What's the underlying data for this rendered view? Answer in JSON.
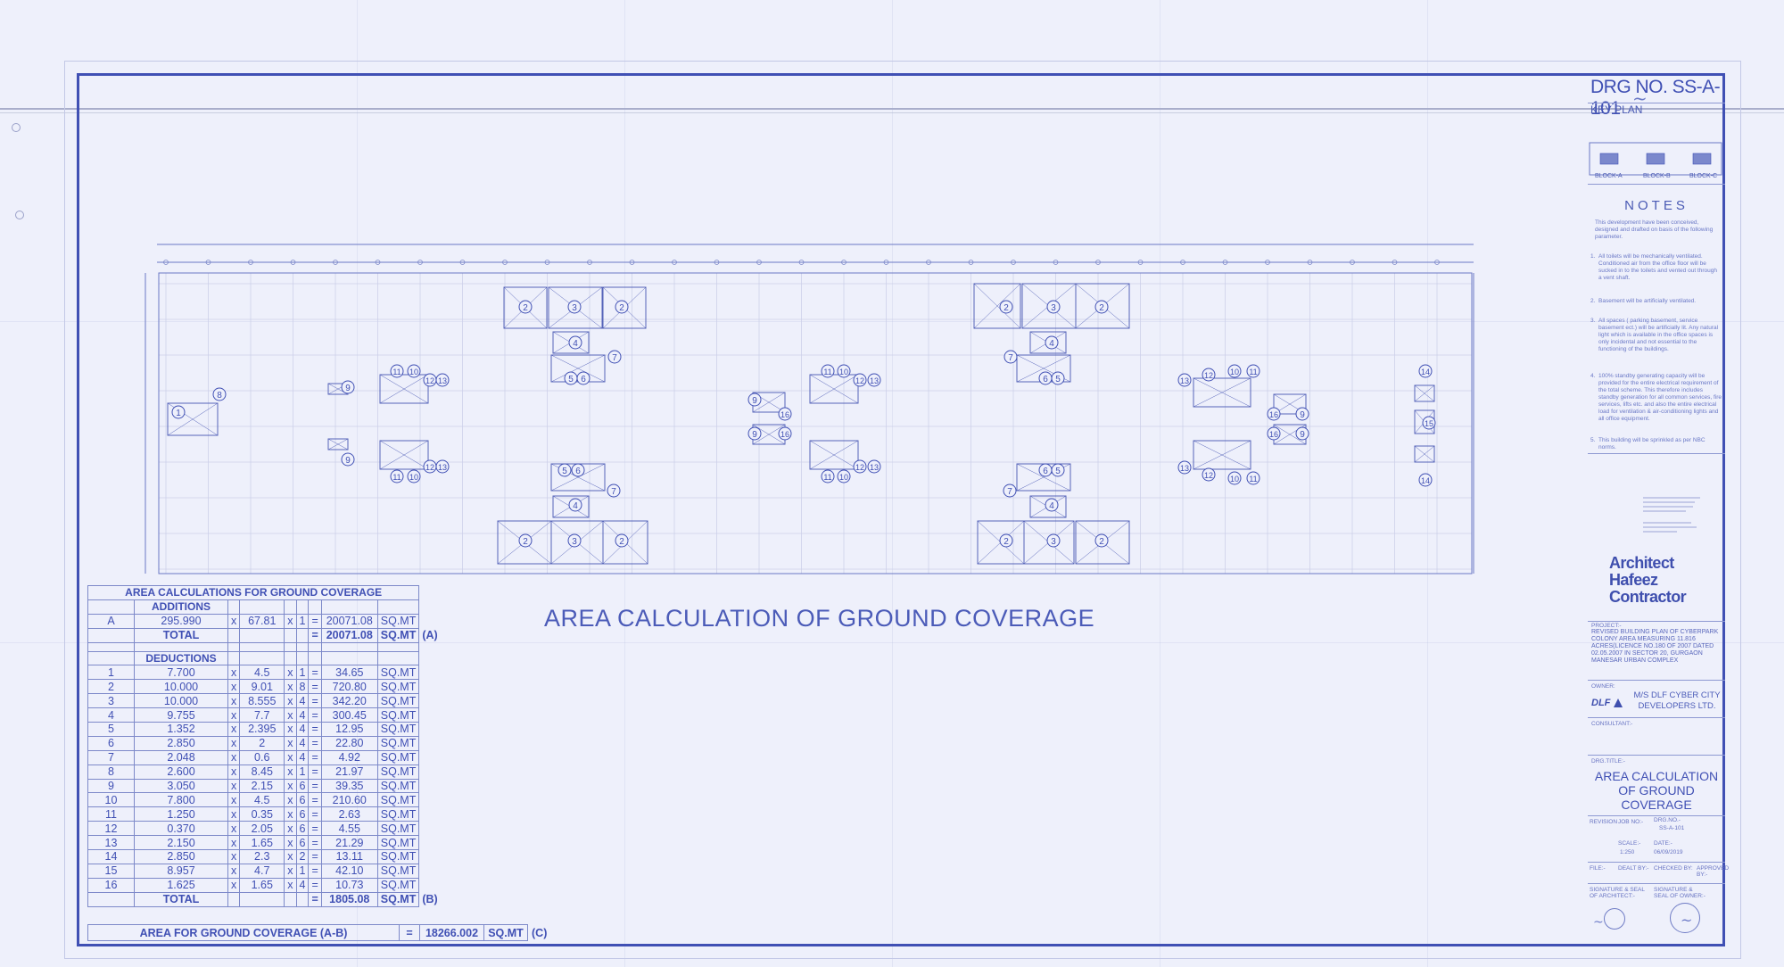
{
  "drawing_number": "DRG NO. SS-A-101",
  "plan_title": "AREA CALCULATION OF GROUND COVERAGE",
  "calc_table": {
    "title": "AREA CALCULATIONS FOR GROUND COVERAGE",
    "additions_header": "ADDITIONS",
    "additions": [
      {
        "id": "A",
        "area": "295.990",
        "x1": "x",
        "mult1": "67.81",
        "x2": "x",
        "mult2": "1",
        "eq": "=",
        "result": "20071.08",
        "unit": "SQ.MT"
      }
    ],
    "additions_total": {
      "label": "TOTAL",
      "eq": "=",
      "result": "20071.08",
      "unit": "SQ.MT",
      "tag": "(A)"
    },
    "deductions_header": "DEDUCTIONS",
    "deductions": [
      {
        "id": "1",
        "area": "7.700",
        "x1": "x",
        "mult1": "4.5",
        "x2": "x",
        "mult2": "1",
        "eq": "=",
        "result": "34.65",
        "unit": "SQ.MT"
      },
      {
        "id": "2",
        "area": "10.000",
        "x1": "x",
        "mult1": "9.01",
        "x2": "x",
        "mult2": "8",
        "eq": "=",
        "result": "720.80",
        "unit": "SQ.MT"
      },
      {
        "id": "3",
        "area": "10.000",
        "x1": "x",
        "mult1": "8.555",
        "x2": "x",
        "mult2": "4",
        "eq": "=",
        "result": "342.20",
        "unit": "SQ.MT"
      },
      {
        "id": "4",
        "area": "9.755",
        "x1": "x",
        "mult1": "7.7",
        "x2": "x",
        "mult2": "4",
        "eq": "=",
        "result": "300.45",
        "unit": "SQ.MT"
      },
      {
        "id": "5",
        "area": "1.352",
        "x1": "x",
        "mult1": "2.395",
        "x2": "x",
        "mult2": "4",
        "eq": "=",
        "result": "12.95",
        "unit": "SQ.MT"
      },
      {
        "id": "6",
        "area": "2.850",
        "x1": "x",
        "mult1": "2",
        "x2": "x",
        "mult2": "4",
        "eq": "=",
        "result": "22.80",
        "unit": "SQ.MT"
      },
      {
        "id": "7",
        "area": "2.048",
        "x1": "x",
        "mult1": "0.6",
        "x2": "x",
        "mult2": "4",
        "eq": "=",
        "result": "4.92",
        "unit": "SQ.MT"
      },
      {
        "id": "8",
        "area": "2.600",
        "x1": "x",
        "mult1": "8.45",
        "x2": "x",
        "mult2": "1",
        "eq": "=",
        "result": "21.97",
        "unit": "SQ.MT"
      },
      {
        "id": "9",
        "area": "3.050",
        "x1": "x",
        "mult1": "2.15",
        "x2": "x",
        "mult2": "6",
        "eq": "=",
        "result": "39.35",
        "unit": "SQ.MT"
      },
      {
        "id": "10",
        "area": "7.800",
        "x1": "x",
        "mult1": "4.5",
        "x2": "x",
        "mult2": "6",
        "eq": "=",
        "result": "210.60",
        "unit": "SQ.MT"
      },
      {
        "id": "11",
        "area": "1.250",
        "x1": "x",
        "mult1": "0.35",
        "x2": "x",
        "mult2": "6",
        "eq": "=",
        "result": "2.63",
        "unit": "SQ.MT"
      },
      {
        "id": "12",
        "area": "0.370",
        "x1": "x",
        "mult1": "2.05",
        "x2": "x",
        "mult2": "6",
        "eq": "=",
        "result": "4.55",
        "unit": "SQ.MT"
      },
      {
        "id": "13",
        "area": "2.150",
        "x1": "x",
        "mult1": "1.65",
        "x2": "x",
        "mult2": "6",
        "eq": "=",
        "result": "21.29",
        "unit": "SQ.MT"
      },
      {
        "id": "14",
        "area": "2.850",
        "x1": "x",
        "mult1": "2.3",
        "x2": "x",
        "mult2": "2",
        "eq": "=",
        "result": "13.11",
        "unit": "SQ.MT"
      },
      {
        "id": "15",
        "area": "8.957",
        "x1": "x",
        "mult1": "4.7",
        "x2": "x",
        "mult2": "1",
        "eq": "=",
        "result": "42.10",
        "unit": "SQ.MT"
      },
      {
        "id": "16",
        "area": "1.625",
        "x1": "x",
        "mult1": "1.65",
        "x2": "x",
        "mult2": "4",
        "eq": "=",
        "result": "10.73",
        "unit": "SQ.MT"
      }
    ],
    "deductions_total": {
      "label": "TOTAL",
      "eq": "=",
      "result": "1805.08",
      "unit": "SQ.MT",
      "tag": "(B)"
    },
    "ground_coverage": {
      "label": "AREA  FOR GROUND COVERAGE (A-B)",
      "eq": "=",
      "result": "18266.002",
      "unit": "SQ.MT",
      "tag": "(C)"
    }
  },
  "plan_callouts": [
    "1",
    "2",
    "3",
    "4",
    "5",
    "6",
    "7",
    "8",
    "9",
    "10",
    "11",
    "12",
    "13",
    "14",
    "15",
    "16"
  ],
  "title_block": {
    "key_plan": "KEY PLAN",
    "blocks": [
      "BLOCK-A",
      "BLOCK-B",
      "BLOCK-C"
    ],
    "notes_title": "NOTES",
    "notes_intro": "This development have been conceived, designed and drafted on basis of the following parameter.",
    "notes": [
      {
        "num": "1.",
        "text": "All toilets will be mechanically ventilated. Conditioned air from the office floor will be sucked in to the toilets and vented out through a vent shaft."
      },
      {
        "num": "2.",
        "text": "Basement will be artificially ventilated."
      },
      {
        "num": "3.",
        "text": "All spaces ( parking basement, service basement ect.) will be artificially lit. Any natural light which is available in the office spaces is only incidental and not essential to the functioning of the buildings."
      },
      {
        "num": "4.",
        "text": "100% standby generating capacity will be provided for the entire electrical requirement of the total scheme. This therefore includes standby generation for all common services, fire services, lifts etc. and also the entire electrical load for ventilation & air-conditioning lights and all office equipment."
      },
      {
        "num": "5.",
        "text": "This building will be sprinkled as per NBC norms."
      }
    ],
    "firm_line1": "Architect",
    "firm_line2": "Hafeez",
    "firm_line3": "Contractor",
    "project_label": "PROJECT:-",
    "project": "REVISED BUILDING PLAN OF CYBERPARK COLONY AREA MEASURING 11.816 ACRES(LICENCE NO.180 OF 2007 DATED 02.05.2007 IN SECTOR 20, GURGAON MANESAR URBAN COMPLEX",
    "owner_label": "OWNER:",
    "owner_logo": "DLF",
    "owner": "M/S  DLF CYBER CITY DEVELOPERS LTD.",
    "consultant_label": "CONSULTANT:-",
    "dwg_title_label": "DRG.TITLE:-",
    "dwg_title": "AREA CALCULATION OF GROUND COVERAGE",
    "revision_label": "REVISION",
    "job_no_label": "JOB NO:-",
    "drg_no_label": "DRG.NO.-",
    "drg_no_value": "SS-A-101",
    "scale_label": "SCALE:-",
    "scale_value": "1:250",
    "date_label": "DATE:-",
    "date_value": "06/09/2019",
    "file_label": "FILE:-",
    "dealt_label": "DEALT BY:-",
    "checked_label": "CHECKED BY:",
    "approved_label": "APPROVED BY:-",
    "sig_architect": "SIGNATURE & SEAL OF ARCHITECT:-",
    "sig_owner": "SIGNATURE & SEAL OF OWNER:-"
  },
  "colors": {
    "ink": "#4050b4",
    "paper": "#eef0fb",
    "grid": "#c7cce8"
  }
}
